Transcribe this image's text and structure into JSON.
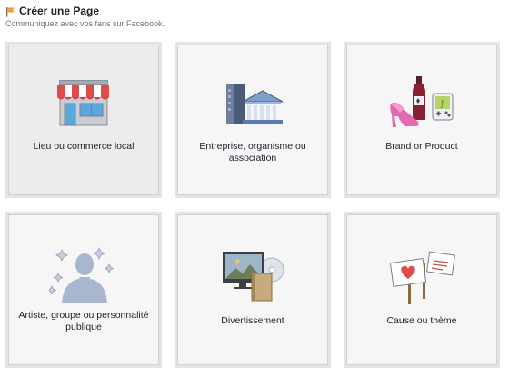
{
  "header": {
    "title": "Créer une Page",
    "subtitle": "Communiquez avec vos fans sur Facebook."
  },
  "cards": [
    {
      "label": "Lieu ou commerce local",
      "icon": "storefront-icon"
    },
    {
      "label": "Entreprise, organisme ou association",
      "icon": "buildings-icon"
    },
    {
      "label": "Brand or Product",
      "icon": "products-icon"
    },
    {
      "label": "Artiste, groupe ou personnalité publique",
      "icon": "artist-silhouette-icon"
    },
    {
      "label": "Divertissement",
      "icon": "entertainment-icon"
    },
    {
      "label": "Cause ou thème",
      "icon": "protest-signs-icon"
    }
  ],
  "colors": {
    "title": "#1d2129",
    "subtitle": "#6d737f",
    "card_bg": "#f6f6f7",
    "card_selected_bg": "#ececed",
    "card_border": "#e3e4e7",
    "awning_red": "#e04b4b",
    "facebook_blue": "#3b5998"
  }
}
